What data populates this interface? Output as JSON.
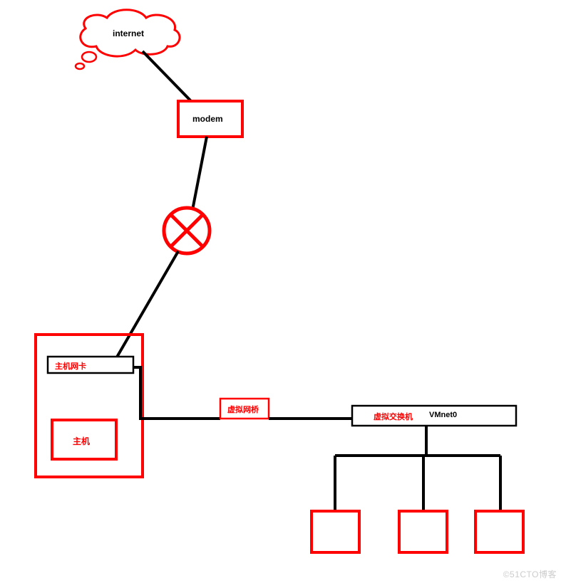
{
  "labels": {
    "internet": "internet",
    "modem": "modem",
    "host_nic": "主机网卡",
    "host": "主机",
    "virtual_bridge": "虚拟网桥",
    "virtual_switch": "虚拟交换机",
    "vmnet": "VMnet0"
  },
  "colors": {
    "red": "#ff0000",
    "black": "#000000"
  },
  "watermark": "©51CTO博客"
}
